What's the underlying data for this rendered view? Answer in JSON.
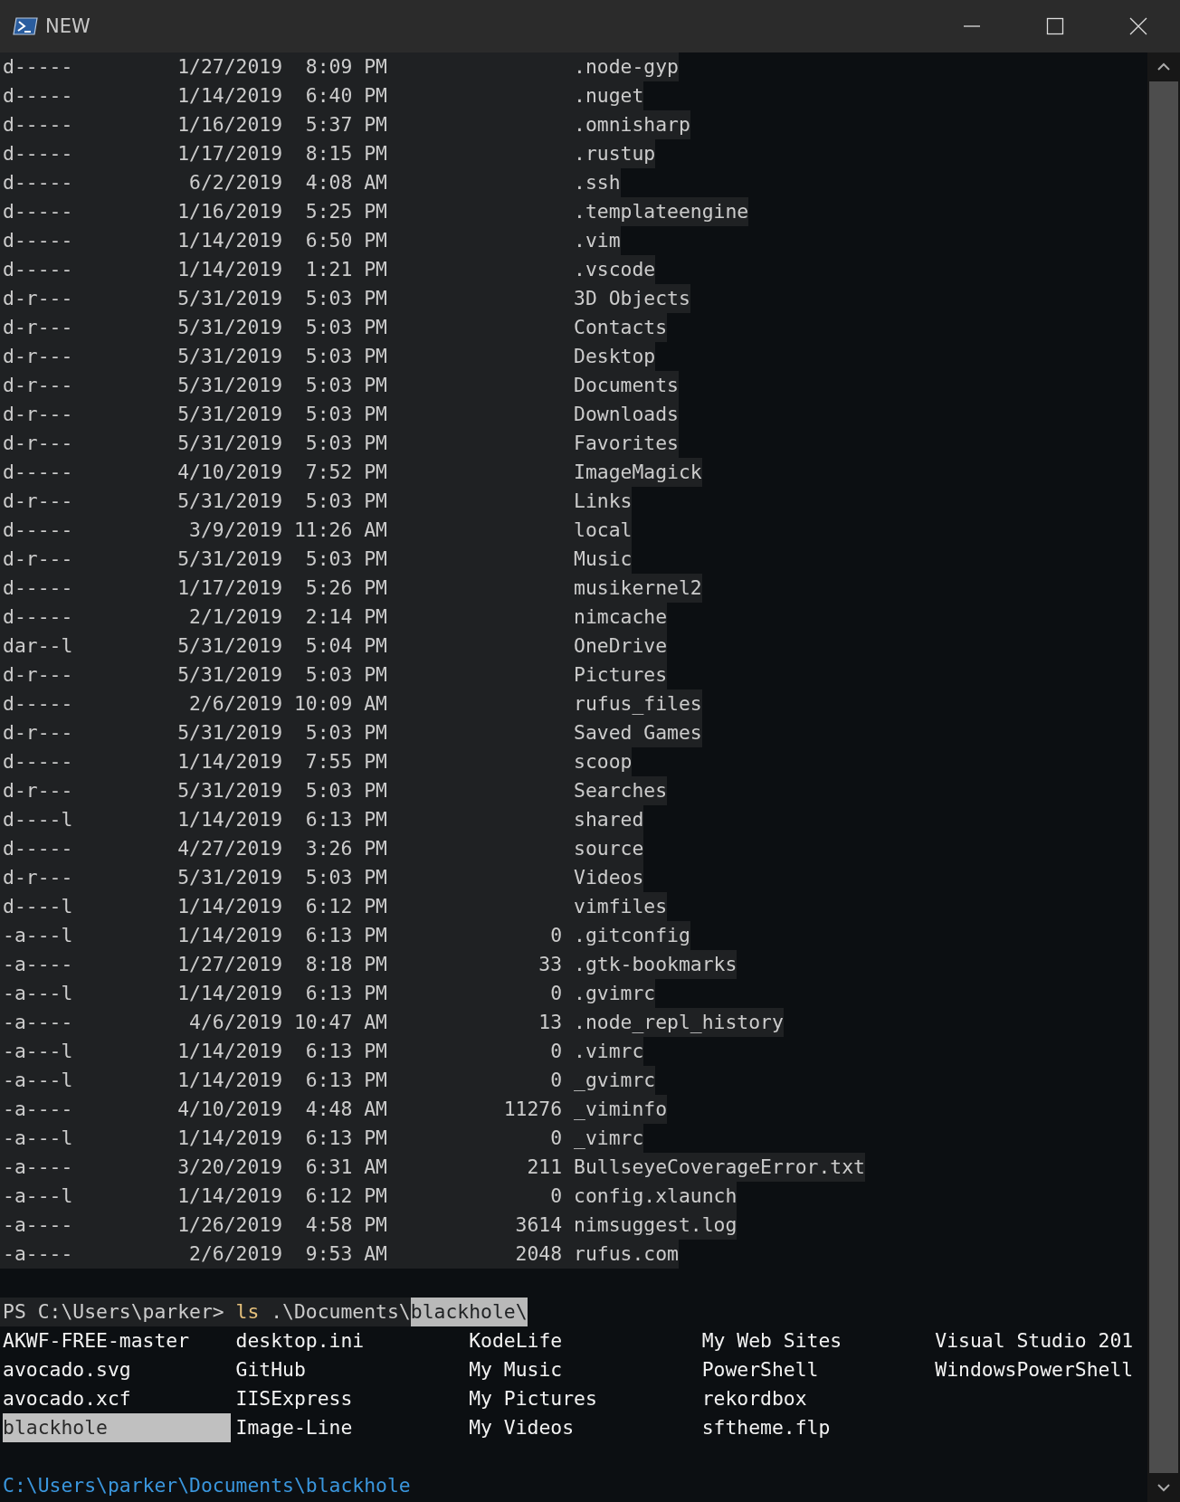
{
  "window": {
    "title": "NEW"
  },
  "listing": [
    {
      "mode": "d-----",
      "date": "1/27/2019",
      "time": "8:09 PM",
      "name": ".node-gyp"
    },
    {
      "mode": "d-----",
      "date": "1/14/2019",
      "time": "6:40 PM",
      "name": ".nuget"
    },
    {
      "mode": "d-----",
      "date": "1/16/2019",
      "time": "5:37 PM",
      "name": ".omnisharp"
    },
    {
      "mode": "d-----",
      "date": "1/17/2019",
      "time": "8:15 PM",
      "name": ".rustup"
    },
    {
      "mode": "d-----",
      "date": "6/2/2019",
      "time": "4:08 AM",
      "name": ".ssh"
    },
    {
      "mode": "d-----",
      "date": "1/16/2019",
      "time": "5:25 PM",
      "name": ".templateengine"
    },
    {
      "mode": "d-----",
      "date": "1/14/2019",
      "time": "6:50 PM",
      "name": ".vim"
    },
    {
      "mode": "d-----",
      "date": "1/14/2019",
      "time": "1:21 PM",
      "name": ".vscode"
    },
    {
      "mode": "d-r---",
      "date": "5/31/2019",
      "time": "5:03 PM",
      "name": "3D Objects"
    },
    {
      "mode": "d-r---",
      "date": "5/31/2019",
      "time": "5:03 PM",
      "name": "Contacts"
    },
    {
      "mode": "d-r---",
      "date": "5/31/2019",
      "time": "5:03 PM",
      "name": "Desktop"
    },
    {
      "mode": "d-r---",
      "date": "5/31/2019",
      "time": "5:03 PM",
      "name": "Documents"
    },
    {
      "mode": "d-r---",
      "date": "5/31/2019",
      "time": "5:03 PM",
      "name": "Downloads"
    },
    {
      "mode": "d-r---",
      "date": "5/31/2019",
      "time": "5:03 PM",
      "name": "Favorites"
    },
    {
      "mode": "d-----",
      "date": "4/10/2019",
      "time": "7:52 PM",
      "name": "ImageMagick"
    },
    {
      "mode": "d-r---",
      "date": "5/31/2019",
      "time": "5:03 PM",
      "name": "Links"
    },
    {
      "mode": "d-----",
      "date": "3/9/2019",
      "time": "11:26 AM",
      "name": "local"
    },
    {
      "mode": "d-r---",
      "date": "5/31/2019",
      "time": "5:03 PM",
      "name": "Music"
    },
    {
      "mode": "d-----",
      "date": "1/17/2019",
      "time": "5:26 PM",
      "name": "musikernel2"
    },
    {
      "mode": "d-----",
      "date": "2/1/2019",
      "time": "2:14 PM",
      "name": "nimcache"
    },
    {
      "mode": "dar--l",
      "date": "5/31/2019",
      "time": "5:04 PM",
      "name": "OneDrive"
    },
    {
      "mode": "d-r---",
      "date": "5/31/2019",
      "time": "5:03 PM",
      "name": "Pictures"
    },
    {
      "mode": "d-----",
      "date": "2/6/2019",
      "time": "10:09 AM",
      "name": "rufus_files"
    },
    {
      "mode": "d-r---",
      "date": "5/31/2019",
      "time": "5:03 PM",
      "name": "Saved Games"
    },
    {
      "mode": "d-----",
      "date": "1/14/2019",
      "time": "7:55 PM",
      "name": "scoop"
    },
    {
      "mode": "d-r---",
      "date": "5/31/2019",
      "time": "5:03 PM",
      "name": "Searches"
    },
    {
      "mode": "d----l",
      "date": "1/14/2019",
      "time": "6:13 PM",
      "name": "shared"
    },
    {
      "mode": "d-----",
      "date": "4/27/2019",
      "time": "3:26 PM",
      "name": "source"
    },
    {
      "mode": "d-r---",
      "date": "5/31/2019",
      "time": "5:03 PM",
      "name": "Videos"
    },
    {
      "mode": "d----l",
      "date": "1/14/2019",
      "time": "6:12 PM",
      "name": "vimfiles"
    },
    {
      "mode": "-a---l",
      "date": "1/14/2019",
      "time": "6:13 PM",
      "length": "0",
      "name": ".gitconfig"
    },
    {
      "mode": "-a----",
      "date": "1/27/2019",
      "time": "8:18 PM",
      "length": "33",
      "name": ".gtk-bookmarks"
    },
    {
      "mode": "-a---l",
      "date": "1/14/2019",
      "time": "6:13 PM",
      "length": "0",
      "name": ".gvimrc"
    },
    {
      "mode": "-a----",
      "date": "4/6/2019",
      "time": "10:47 AM",
      "length": "13",
      "name": ".node_repl_history"
    },
    {
      "mode": "-a---l",
      "date": "1/14/2019",
      "time": "6:13 PM",
      "length": "0",
      "name": ".vimrc"
    },
    {
      "mode": "-a---l",
      "date": "1/14/2019",
      "time": "6:13 PM",
      "length": "0",
      "name": "_gvimrc"
    },
    {
      "mode": "-a----",
      "date": "4/10/2019",
      "time": "4:48 AM",
      "length": "11276",
      "name": "_viminfo"
    },
    {
      "mode": "-a---l",
      "date": "1/14/2019",
      "time": "6:13 PM",
      "length": "0",
      "name": "_vimrc"
    },
    {
      "mode": "-a----",
      "date": "3/20/2019",
      "time": "6:31 AM",
      "length": "211",
      "name": "BullseyeCoverageError.txt"
    },
    {
      "mode": "-a---l",
      "date": "1/14/2019",
      "time": "6:12 PM",
      "length": "0",
      "name": "config.xlaunch"
    },
    {
      "mode": "-a----",
      "date": "1/26/2019",
      "time": "4:58 PM",
      "length": "3614",
      "name": "nimsuggest.log"
    },
    {
      "mode": "-a----",
      "date": "2/6/2019",
      "time": "9:53 AM",
      "length": "2048",
      "name": "rufus.com"
    }
  ],
  "prompt": {
    "prefix": "PS C:\\Users\\parker>",
    "command": "ls",
    "argument": ".\\Documents\\",
    "completion": "blackhole\\"
  },
  "completion_menu": {
    "items": [
      {
        "label": "AKWF-FREE-master",
        "selected": false
      },
      {
        "label": "avocado.svg",
        "selected": false
      },
      {
        "label": "avocado.xcf",
        "selected": false
      },
      {
        "label": "blackhole",
        "selected": true
      },
      {
        "label": "desktop.ini",
        "selected": false
      },
      {
        "label": "GitHub",
        "selected": false
      },
      {
        "label": "IISExpress",
        "selected": false
      },
      {
        "label": "Image-Line",
        "selected": false
      },
      {
        "label": "KodeLife",
        "selected": false
      },
      {
        "label": "My Music",
        "selected": false
      },
      {
        "label": "My Pictures",
        "selected": false
      },
      {
        "label": "My Videos",
        "selected": false
      },
      {
        "label": "My Web Sites",
        "selected": false
      },
      {
        "label": "PowerShell",
        "selected": false
      },
      {
        "label": "rekordbox",
        "selected": false
      },
      {
        "label": "sftheme.flp",
        "selected": false
      },
      {
        "label": "Visual Studio 201",
        "selected": false
      },
      {
        "label": "WindowsPowerShell",
        "selected": false
      }
    ]
  },
  "status_path": "C:\\Users\\parker\\Documents\\blackhole"
}
